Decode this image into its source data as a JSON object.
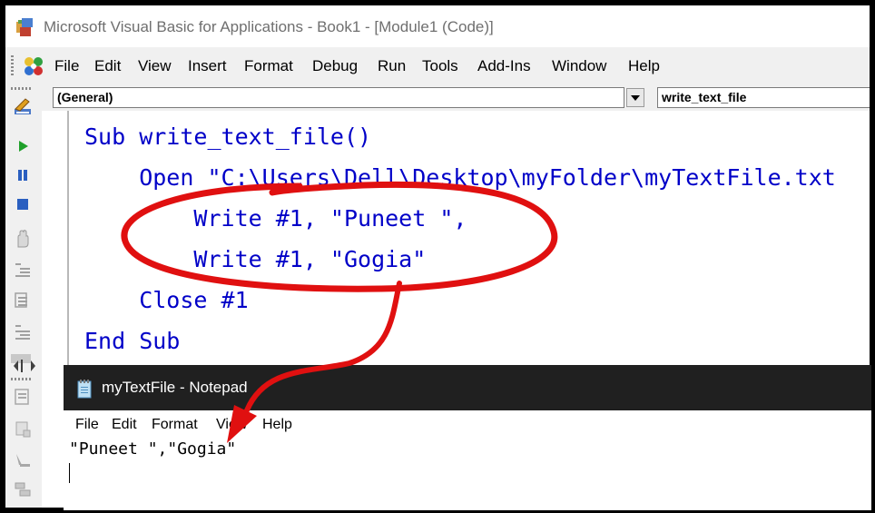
{
  "window": {
    "title": "Microsoft Visual Basic for Applications - Book1 - [Module1 (Code)]",
    "app_icon": "vba-app-icon"
  },
  "menu": {
    "items": [
      "File",
      "Edit",
      "View",
      "Insert",
      "Format",
      "Debug",
      "Run",
      "Tools",
      "Add-Ins",
      "Window",
      "Help"
    ]
  },
  "toolbar": {
    "icons": [
      "design-mode-icon",
      "run-icon",
      "break-icon",
      "reset-icon",
      "hand-icon",
      "indent-icon",
      "outdent-icon",
      "toggle-breakpoint-icon",
      "step-icon",
      "comment-icon",
      "uncomment-icon",
      "bookmark-icon",
      "next-bookmark-icon"
    ]
  },
  "combos": {
    "object": "(General)",
    "procedure": "write_text_file"
  },
  "code": {
    "lines": [
      "Sub write_text_file()",
      "    Open \"C:\\Users\\Dell\\Desktop\\myFolder\\myTextFile.txt",
      "        Write #1, \"Puneet \",",
      "        Write #1, \"Gogia\"",
      "    Close #1",
      "End Sub"
    ]
  },
  "notepad": {
    "title": "myTextFile - Notepad",
    "menu": [
      "File",
      "Edit",
      "Format",
      "View",
      "Help"
    ],
    "content": "\"Puneet \",\"Gogia\""
  },
  "colors": {
    "code_keyword": "#0000c8",
    "annotation": "#e01010",
    "notepad_title_bg": "#202020"
  }
}
